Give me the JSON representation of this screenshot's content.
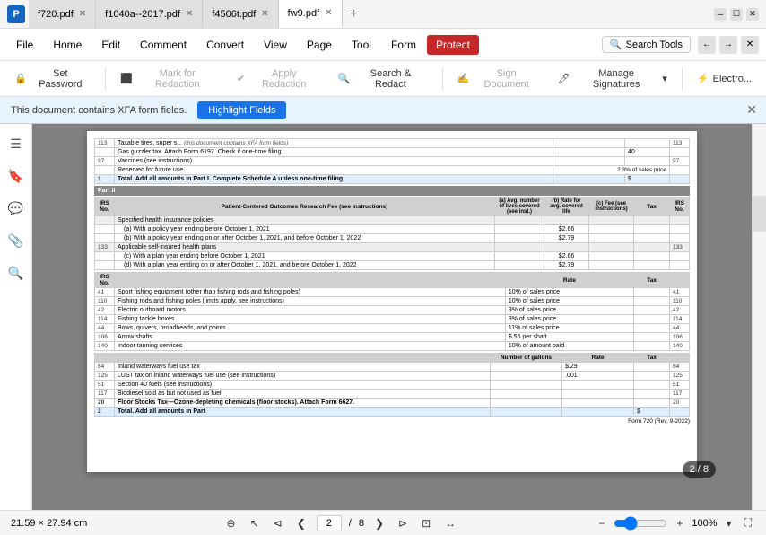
{
  "titlebar": {
    "app_icon": "P",
    "tabs": [
      {
        "label": "f720.pdf",
        "active": false,
        "closable": true
      },
      {
        "label": "f1040a--2017.pdf",
        "active": false,
        "closable": true
      },
      {
        "label": "f4506t.pdf",
        "active": false,
        "closable": true
      },
      {
        "label": "fw9.pdf",
        "active": true,
        "closable": true
      }
    ],
    "add_tab": "+",
    "window_controls": [
      "—",
      "☐",
      "✕"
    ]
  },
  "menu": {
    "file": "File",
    "home": "Home",
    "edit": "Edit",
    "comment": "Comment",
    "convert": "Convert",
    "view": "View",
    "page": "Page",
    "tool": "Tool",
    "form": "Form",
    "protect": "Protect",
    "search_tools": "Search Tools"
  },
  "toolbar": {
    "set_password": "Set Password",
    "mark_for_redaction": "Mark for Redaction",
    "apply_redaction": "Apply Redaction",
    "search_redact": "Search & Redact",
    "sign_document": "Sign Document",
    "manage_signatures": "Manage Signatures",
    "electro": "Electro..."
  },
  "notification": {
    "message": "This document contains XFA form fields.",
    "button": "Highlight Fields",
    "close": "✕"
  },
  "sidebar_icons": [
    "☰",
    "🔖",
    "💬",
    "📎",
    "🔍"
  ],
  "pdf": {
    "rows": [
      {
        "num": "113",
        "desc": "Taxable tires, super s...",
        "rate": "",
        "tax": "113"
      },
      {
        "num": "",
        "desc": "Gas guzzler tax. Attach Form 6197. Check if one-time filing",
        "rate": "",
        "tax": "40"
      },
      {
        "num": "97",
        "desc": "Vaccines (see instructions)",
        "rate": "",
        "tax": "97"
      },
      {
        "num": "",
        "desc": "Reserved for future use",
        "rate": "2.3% of sales price",
        "tax": ""
      },
      {
        "num": "1",
        "desc": "Total. Add all amounts in Part I. Complete Schedule A unless one-time filing",
        "rate": "",
        "tax": "$",
        "bold": true
      }
    ],
    "part2_header": "Part II",
    "part2_cols": [
      "IRS No.",
      "Patient-Centered Outcomes Research Fee (see instructions)",
      "(a) Avg. number of lives covered (see inst.)",
      "(b) Rate for avg. covered life",
      "(c) Fee (see instructions)",
      "Tax",
      "IRS No."
    ],
    "part2_rows": [
      {
        "irs": "",
        "desc": "Specified health insurance policies",
        "a": "",
        "b": "",
        "c": "",
        "tax": "",
        "num": ""
      },
      {
        "irs": "",
        "desc": "(a) With a policy year ending before October 1, 2021",
        "a": "",
        "b": "$2.66",
        "c": "",
        "tax": "",
        "num": ""
      },
      {
        "irs": "",
        "desc": "(b) With a policy year ending on or after October 1, 2021, and before October 1, 2022",
        "a": "",
        "b": "$2.79",
        "c": "",
        "tax": "",
        "num": ""
      },
      {
        "irs": "133",
        "desc": "Applicable self-insured health plans",
        "a": "",
        "b": "",
        "c": "",
        "tax": "",
        "num": "133"
      },
      {
        "irs": "",
        "desc": "(c) With a plan year ending before October 1, 2021",
        "a": "",
        "b": "$2.66",
        "c": "",
        "tax": "",
        "num": ""
      },
      {
        "irs": "",
        "desc": "(d) With a plan year ending on or after October 1, 2021, and before October 1, 2022",
        "a": "",
        "b": "$2.79",
        "c": "",
        "tax": "",
        "num": ""
      }
    ],
    "rate_section": [
      {
        "num": "41",
        "desc": "Sport fishing equipment (other than fishing rods and fishing poles)",
        "rate": "10% of sales price",
        "tax": "",
        "rnum": "41"
      },
      {
        "num": "110",
        "desc": "Fishing rods and fishing poles (limits apply, see instructions)",
        "rate": "10% of sales price",
        "tax": "",
        "rnum": "110"
      },
      {
        "num": "42",
        "desc": "Electric outboard motors",
        "rate": "3% of sales price",
        "tax": "",
        "rnum": "42"
      },
      {
        "num": "114",
        "desc": "Fishing tackle boxes",
        "rate": "3% of sales price",
        "tax": "",
        "rnum": "114"
      },
      {
        "num": "44",
        "desc": "Bows, quivers, broadheads, and points",
        "rate": "11% of sales price",
        "tax": "",
        "rnum": "44"
      },
      {
        "num": "106",
        "desc": "Arrow shafts",
        "rate": "$.55 per shaft",
        "tax": "",
        "rnum": "106"
      },
      {
        "num": "140",
        "desc": "Indoor tanning services",
        "rate": "10% of amount paid",
        "tax": "",
        "rnum": "140"
      }
    ],
    "gallons_section": [
      {
        "num": "64",
        "desc": "Inland waterways fuel use tax",
        "rate": "$.29",
        "tax": "",
        "rnum": "64"
      },
      {
        "num": "125",
        "desc": "LUST tax on inland waterways fuel use (see instructions)",
        "rate": ".001",
        "tax": "",
        "rnum": "125"
      },
      {
        "num": "51",
        "desc": "Section 40 fuels (see instructions)",
        "rate": "",
        "tax": "",
        "rnum": "51"
      },
      {
        "num": "117",
        "desc": "Biodiesel sold as but not used as fuel",
        "rate": "",
        "tax": "",
        "rnum": "117"
      },
      {
        "num": "20",
        "desc": "Floor Stocks Tax—Ozone-depleting chemicals (floor stocks). Attach Form 6627.",
        "rate": "",
        "tax": "",
        "rnum": "20"
      },
      {
        "num": "2",
        "desc": "Total. Add all amounts in Part",
        "rate": "",
        "tax": "$",
        "rnum": "",
        "bold": true
      }
    ],
    "form_label": "Form 720 (Rev. 9-2022)",
    "gallons_header": "Number of gallons",
    "rate_header": "Rate",
    "tax_header": "Tax"
  },
  "status": {
    "page_size": "21.59 × 27.94 cm",
    "current_page": "2",
    "total_pages": "8",
    "page_display": "2 / 8",
    "zoom": "100%",
    "nav_first": "⊲",
    "nav_prev": "❮",
    "nav_next": "❯",
    "nav_last": "⊳"
  }
}
